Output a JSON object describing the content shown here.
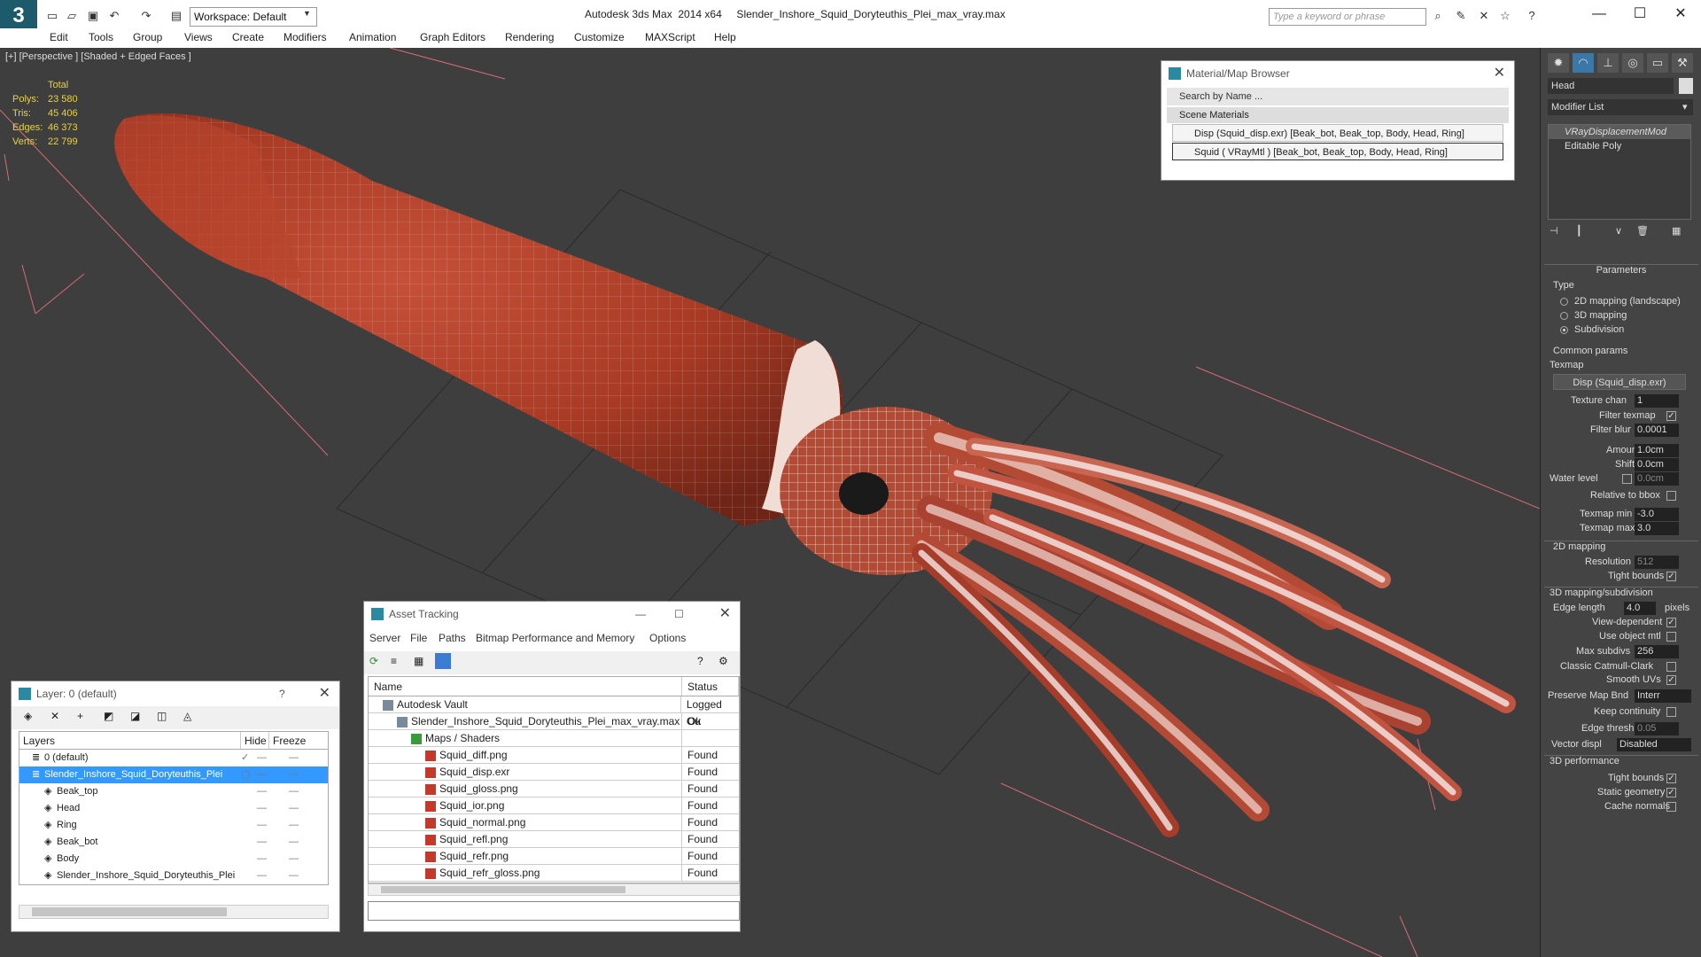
{
  "titlebar": {
    "workspace": "Workspace: Default",
    "window_title": "Autodesk 3ds Max  2014 x64     Slender_Inshore_Squid_Doryteuthis_Plei_max_vray.max",
    "search_placeholder": "Type a keyword or phrase"
  },
  "menu": [
    "Edit",
    "Tools",
    "Group",
    "Views",
    "Create",
    "Modifiers",
    "Animation",
    "Graph Editors",
    "Rendering",
    "Customize",
    "MAXScript",
    "Help"
  ],
  "viewport": {
    "label": "[+] [Perspective ] [Shaded + Edged Faces ]",
    "stats": {
      "total": "Total",
      "rows": [
        {
          "k": "Polys:",
          "v": "23 580"
        },
        {
          "k": "Tris:",
          "v": "45 406"
        },
        {
          "k": "Edges:",
          "v": "46 373"
        },
        {
          "k": "Verts:",
          "v": "22 799"
        }
      ]
    }
  },
  "material_browser": {
    "title": "Material/Map Browser",
    "search": "Search by Name ...",
    "section": "Scene Materials",
    "items": [
      "Disp (Squid_disp.exr) [Beak_bot, Beak_top, Body, Head, Ring]",
      "Squid  ( VRayMtl ) [Beak_bot, Beak_top, Body, Head, Ring]"
    ]
  },
  "asset_tracking": {
    "title": "Asset Tracking",
    "menu": [
      "Server",
      "File",
      "Paths",
      "Bitmap Performance and Memory",
      "Options"
    ],
    "columns": [
      "Name",
      "Status"
    ],
    "rows": [
      {
        "name": "Autodesk Vault",
        "status": "Logged Ou",
        "indent": 1
      },
      {
        "name": "Slender_Inshore_Squid_Doryteuthis_Plei_max_vray.max",
        "status": "Ok",
        "indent": 2
      },
      {
        "name": "Maps / Shaders",
        "status": "",
        "indent": 3
      },
      {
        "name": "Squid_diff.png",
        "status": "Found",
        "indent": 4
      },
      {
        "name": "Squid_disp.exr",
        "status": "Found",
        "indent": 4
      },
      {
        "name": "Squid_gloss.png",
        "status": "Found",
        "indent": 4
      },
      {
        "name": "Squid_ior.png",
        "status": "Found",
        "indent": 4
      },
      {
        "name": "Squid_normal.png",
        "status": "Found",
        "indent": 4
      },
      {
        "name": "Squid_refl.png",
        "status": "Found",
        "indent": 4
      },
      {
        "name": "Squid_refr.png",
        "status": "Found",
        "indent": 4
      },
      {
        "name": "Squid_refr_gloss.png",
        "status": "Found",
        "indent": 4
      }
    ]
  },
  "layer_window": {
    "title": "Layer: 0 (default)",
    "help": "?",
    "columns": [
      "Layers",
      "Hide",
      "Freeze"
    ],
    "rows": [
      {
        "name": "0 (default)",
        "indent": 0
      },
      {
        "name": "Slender_Inshore_Squid_Doryteuthis_Plei",
        "indent": 0
      },
      {
        "name": "Beak_top",
        "indent": 1
      },
      {
        "name": "Head",
        "indent": 1
      },
      {
        "name": "Ring",
        "indent": 1
      },
      {
        "name": "Beak_bot",
        "indent": 1
      },
      {
        "name": "Body",
        "indent": 1
      },
      {
        "name": "Slender_Inshore_Squid_Doryteuthis_Plei",
        "indent": 1
      }
    ]
  },
  "command_panel": {
    "object_name": "Head",
    "modifier_list": "Modifier List",
    "stack": [
      "VRayDisplacementMod",
      "Editable Poly"
    ],
    "rollout_title": "Parameters",
    "type_label": "Type",
    "type_options": [
      "2D mapping (landscape)",
      "3D mapping",
      "Subdivision"
    ],
    "common_params": "Common params",
    "texmap_label": "Texmap",
    "texmap_button": "Disp (Squid_disp.exr)",
    "texture_chan": {
      "label": "Texture chan",
      "value": "1"
    },
    "filter_texmap": "Filter texmap",
    "filter_blur": {
      "label": "Filter blur",
      "value": "0.0001"
    },
    "amount": {
      "label": "Amount",
      "value": "1.0cm"
    },
    "shift": {
      "label": "Shift",
      "value": "0.0cm"
    },
    "water_level": {
      "label": "Water level",
      "value": "0.0cm"
    },
    "relative_bbox": "Relative to bbox",
    "texmap_min": {
      "label": "Texmap min",
      "value": "-3.0"
    },
    "texmap_max": {
      "label": "Texmap max",
      "value": "3.0"
    },
    "mapping_2d": "2D mapping",
    "resolution": {
      "label": "Resolution",
      "value": "512"
    },
    "tight_bounds": "Tight bounds",
    "mapping_3d": "3D mapping/subdivision",
    "edge_length": {
      "label": "Edge length",
      "value": "4.0",
      "unit": "pixels"
    },
    "view_dependent": "View-dependent",
    "use_object_mtl": "Use object mtl",
    "max_subdivs": {
      "label": "Max subdivs",
      "value": "256"
    },
    "classic_catmull": "Classic Catmull-Clark",
    "smooth_uvs": "Smooth UVs",
    "preserve_map_bnd": {
      "label": "Preserve Map Bnd",
      "value": "Interr"
    },
    "keep_continuity": "Keep continuity",
    "edge_thresh": {
      "label": "Edge thresh",
      "value": "0.05"
    },
    "vector_displ": {
      "label": "Vector displ",
      "value": "Disabled"
    },
    "performance_3d": "3D performance",
    "tight_bounds2": "Tight bounds",
    "static_geometry": "Static geometry",
    "cache_normals": "Cache normals"
  },
  "colors": {
    "accent": "#2b8aa0",
    "stats_text": "#e6d24a",
    "squid_body": "#a83a24",
    "selection": "#3399ff"
  }
}
